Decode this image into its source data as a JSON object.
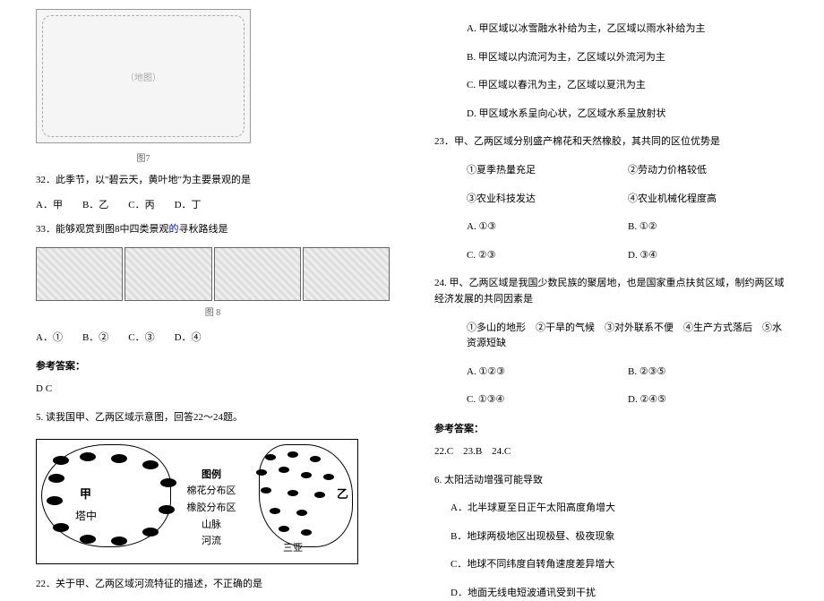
{
  "left": {
    "mapCaption": "图7",
    "q32": {
      "num": "32．",
      "text": "此季节，以\"碧云天，黄叶地\"为主要景观的是",
      "options": "A．甲　　B．乙　　C．丙　　D．丁"
    },
    "q33": {
      "num": "33．",
      "text_part1": "能够观赏到图8中四类景观",
      "text_link": "的",
      "text_part2": "寻秋路线是",
      "photoCaption": "图 8",
      "options": "A．①　　B．②　　C．③　　D．④"
    },
    "answerHeader": "参考答案：",
    "answerText": "D C",
    "q5": {
      "num": "5.",
      "text": " 读我国甲、乙两区域示意图，回答22～24题。"
    },
    "regionMap": {
      "legendTitle": "图例",
      "legend1": "棉花分布区",
      "legend2": "橡胶分布区",
      "legend3": "山脉",
      "legend4": "河流",
      "labelJia": "甲",
      "labelTazhong": "塔中",
      "labelYi": "乙",
      "labelSanya": "三亚"
    },
    "q22": {
      "num": "22．",
      "text": "关于甲、乙两区域河流特征的描述，不正确的是"
    }
  },
  "right": {
    "q22opts": {
      "a": "A. 甲区域以冰雪融水补给为主，乙区域以雨水补给为主",
      "b": "B. 甲区域以内流河为主，乙区域以外流河为主",
      "c": "C. 甲区域以春汛为主，乙区域以夏汛为主",
      "d": "D. 甲区域水系呈向心状，乙区域水系呈放射状"
    },
    "q23": {
      "num": "23．",
      "text": "甲、乙两区域分别盛产棉花和天然橡胶，其共同的区位优势是",
      "c1": "①夏季热量充足",
      "c2": "②劳动力价格较低",
      "c3": "③农业科技发达",
      "c4": "④农业机械化程度高",
      "optA": "A. ①③",
      "optB": "B. ①②",
      "optC": "C. ②③",
      "optD": "D. ③④"
    },
    "q24": {
      "text": "24. 甲、乙两区域是我国少数民族的聚居地，也是国家重点扶贫区域，制约两区域经济发展的共同因素是",
      "conds": "①多山的地形　②干旱的气候　③对外联系不便　④生产方式落后　⑤水资源短缺",
      "optA": "A. ①②③",
      "optB": "B. ②③⑤",
      "optC": "C. ①③④",
      "optD": "D. ②④⑤"
    },
    "answerHeader": "参考答案：",
    "answerText": "22.C　23.B　24.C",
    "q6": {
      "num": "6.",
      "text": " 太阳活动增强可能导致",
      "a": "A．北半球夏至日正午太阳高度角增大",
      "b": "B．地球两极地区出现极昼、极夜现象",
      "c": "C．地球不同纬度自转角速度差异增大",
      "d": "D．地面无线电短波通讯受到干扰"
    }
  }
}
